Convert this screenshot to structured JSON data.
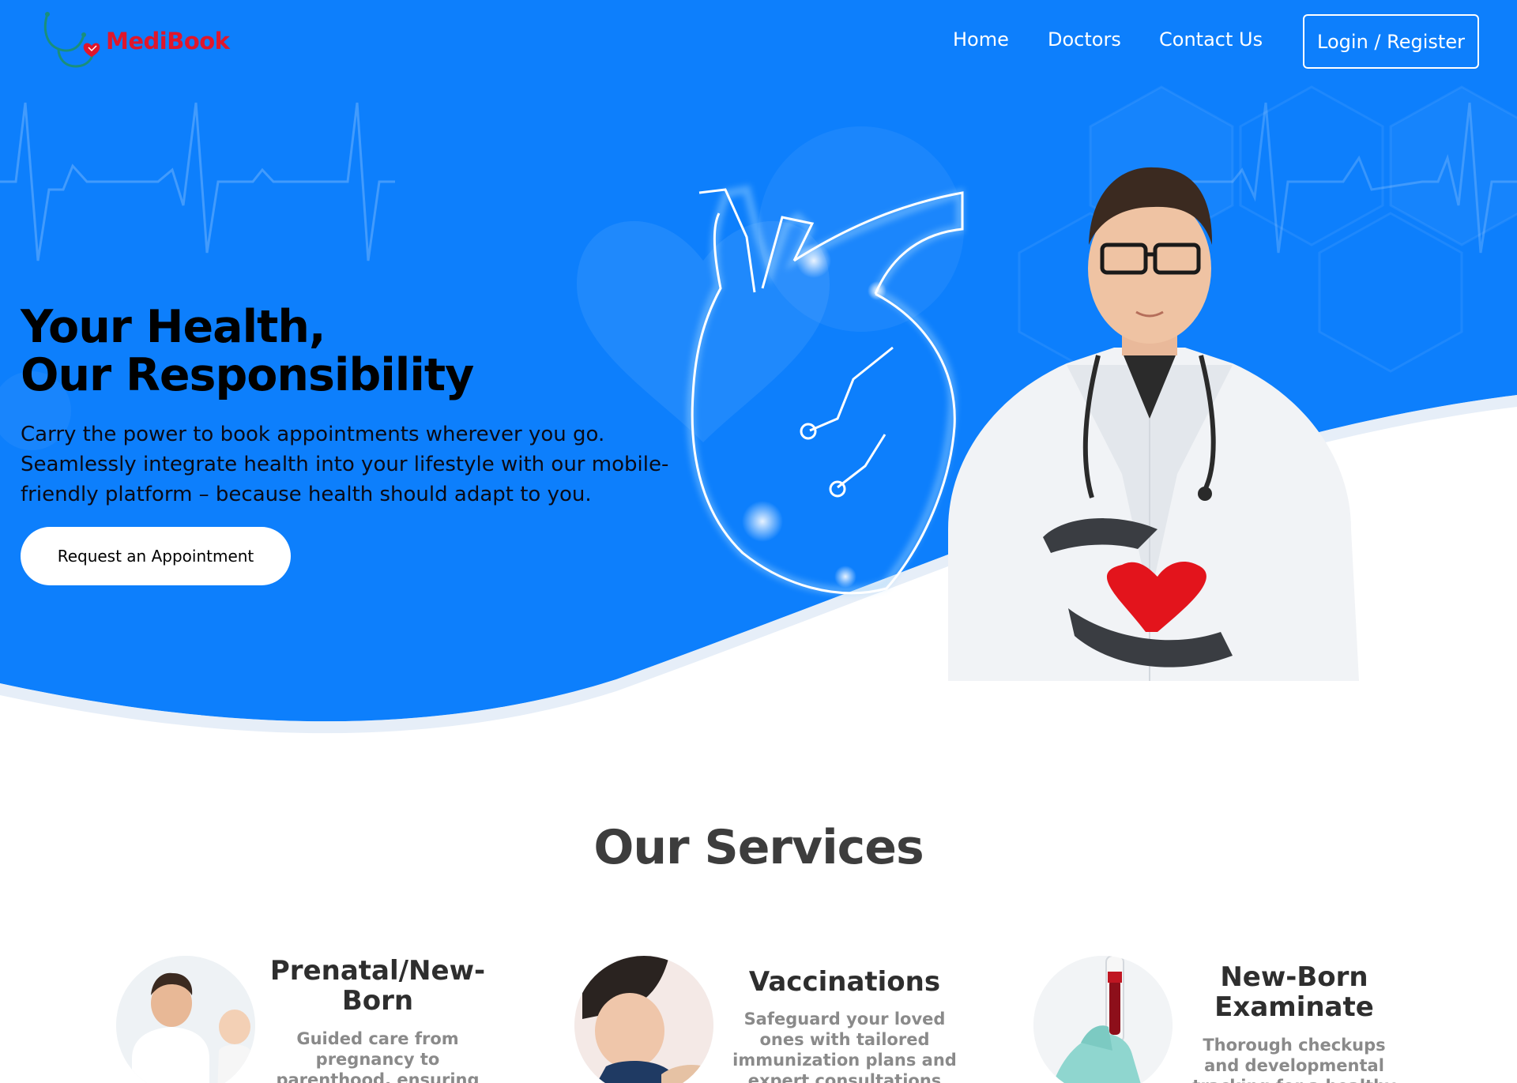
{
  "brand": {
    "name": "MediBook"
  },
  "nav": {
    "items": [
      {
        "label": "Home"
      },
      {
        "label": "Doctors"
      },
      {
        "label": "Contact Us"
      }
    ],
    "login_label": "Login / Register"
  },
  "hero": {
    "title_line1": "Your Health,",
    "title_line2": "Our Responsibility",
    "description": "Carry the power to book appointments wherever you go. Seamlessly integrate health into your lifestyle with our mobile-friendly platform – because health should adapt to you.",
    "cta_label": "Request an Appointment"
  },
  "services": {
    "title": "Our Services",
    "items": [
      {
        "title": "Prenatal/New-Born",
        "description": "Guided care from pregnancy to parenthood, ensuring a"
      },
      {
        "title": "Vaccinations",
        "description": "Safeguard your loved ones with tailored immunization plans and expert consultations"
      },
      {
        "title": "New-Born Examinate",
        "description": "Thorough checkups and developmental tracking for a healthy start in life"
      }
    ]
  },
  "colors": {
    "hero_blue": "#0d7ffc",
    "brand_red": "#e0162b",
    "heading_dark": "#3d3d3d",
    "muted_text": "#8a8a8a"
  },
  "icons": [
    "stethoscope-heart-logo-icon",
    "heart-outline-illustration",
    "doctor-illustration"
  ]
}
